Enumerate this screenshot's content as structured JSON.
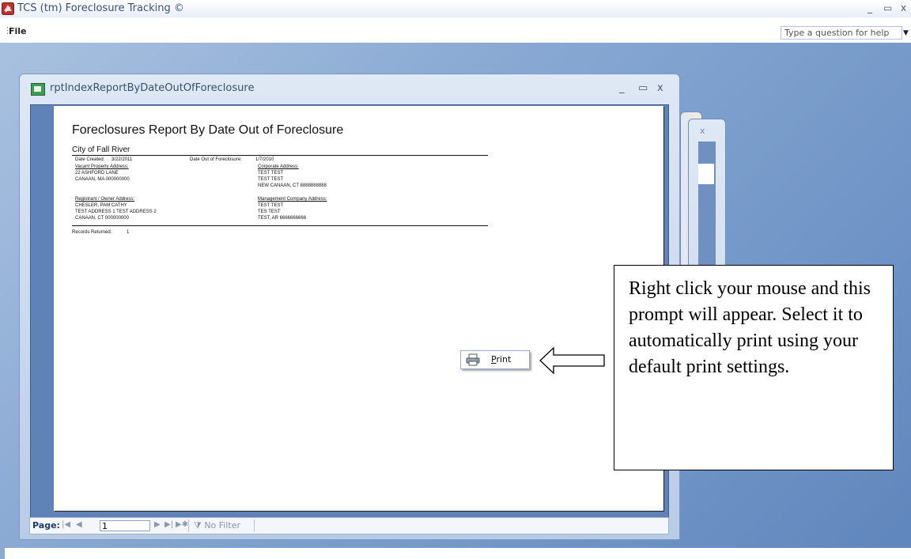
{
  "app": {
    "title": "TCS (tm) Foreclosure Tracking ©",
    "window_controls": [
      "_",
      "▭",
      "x"
    ]
  },
  "menu": {
    "file_label": "File",
    "help_placeholder": "Type a question for help"
  },
  "report_window": {
    "title": "rptIndexReportByDateOutOfForeclosure",
    "controls": [
      "_",
      "▭",
      "x"
    ]
  },
  "report": {
    "title": "Foreclosures Report By Date Out of Foreclosure",
    "city": "City of Fall River",
    "date_created_label": "Date Created:",
    "date_created_value": "3/22/2011",
    "date_out_label": "Date Out of Foreclosure:",
    "date_out_value": "1/7/2010",
    "vacant_property_heading": "Vacant Property Address:",
    "vacant_property_lines": [
      "22 ASHFORD LANE",
      "CANAAN, MA 000000000"
    ],
    "corporate_heading": "Corporate Address:",
    "corporate_lines": [
      "TEST TEST",
      "TEST TEST",
      "NEW CANAAN, CT 8888888888"
    ],
    "registrant_heading": "Registrant / Owner Address:",
    "registrant_lines": [
      "CHESLER, PAM CATHY",
      "TEST ADDRESS 1 TEST ADDRESS 2",
      "CANAAN, CT 000000000"
    ],
    "management_heading": "Management Company Address:",
    "management_lines": [
      "TEST TEST",
      "TES TEST",
      "TEST, AR 6666666666"
    ],
    "records_returned_label": "Records Returned:",
    "records_returned_value": "1"
  },
  "status_bar": {
    "page_label": "Page:",
    "first": "|◀",
    "prev": "◀",
    "page_value": "1",
    "next": "▶",
    "last": "▶|",
    "new": "▶✱",
    "filter_label": "No Filter"
  },
  "context_menu": {
    "print_label": "Print"
  },
  "callout": {
    "text": "Right click your mouse and this prompt will appear. Select it to automatically print using your default print settings."
  },
  "colors": {
    "workspace": "#86a7d2",
    "preview_bg": "#5f82b7",
    "window_title_text": "#3b4f6f"
  },
  "icons": [
    "app-logo-icon",
    "report-window-icon",
    "printer-icon",
    "filter-icon",
    "hollow-arrow-left-icon"
  ]
}
